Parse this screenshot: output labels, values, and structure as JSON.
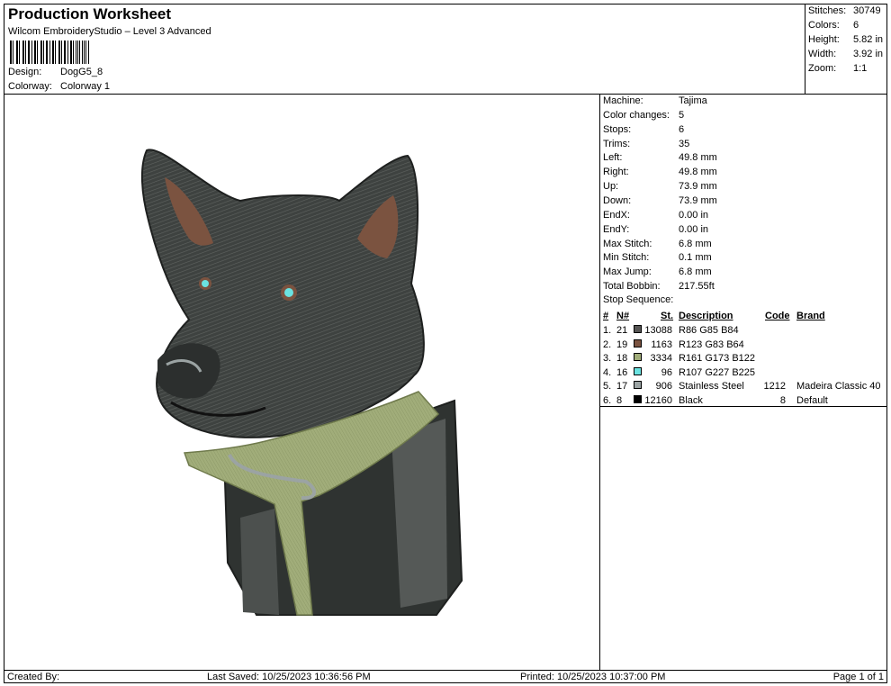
{
  "header": {
    "title": "Production Worksheet",
    "subtitle": "Wilcom EmbroideryStudio – Level 3 Advanced",
    "design_label": "Design:",
    "design_value": "DogG5_8",
    "colorway_label": "Colorway:",
    "colorway_value": "Colorway 1"
  },
  "top_stats": [
    {
      "label": "Stitches:",
      "value": "30749"
    },
    {
      "label": "Colors:",
      "value": "6"
    },
    {
      "label": "Height:",
      "value": "5.82 in"
    },
    {
      "label": "Width:",
      "value": "3.92 in"
    },
    {
      "label": "Zoom:",
      "value": "1:1"
    }
  ],
  "machine_info": [
    {
      "label": "Machine:",
      "value": "Tajima"
    },
    {
      "label": "Color changes:",
      "value": "5"
    },
    {
      "label": "Stops:",
      "value": "6"
    },
    {
      "label": "Trims:",
      "value": "35"
    },
    {
      "label": "Left:",
      "value": "49.8 mm"
    },
    {
      "label": "Right:",
      "value": "49.8 mm"
    },
    {
      "label": "Up:",
      "value": "73.9 mm"
    },
    {
      "label": "Down:",
      "value": "73.9 mm"
    },
    {
      "label": "EndX:",
      "value": "0.00 in"
    },
    {
      "label": "EndY:",
      "value": "0.00 in"
    },
    {
      "label": "Max Stitch:",
      "value": "6.8 mm"
    },
    {
      "label": "Min Stitch:",
      "value": "0.1 mm"
    },
    {
      "label": "Max Jump:",
      "value": "6.8 mm"
    },
    {
      "label": "Total Bobbin:",
      "value": "217.55ft"
    }
  ],
  "stop_sequence": {
    "title": "Stop Sequence:",
    "headers": {
      "num": "#",
      "needle": "N#",
      "stitches": "St.",
      "description": "Description",
      "code": "Code",
      "brand": "Brand"
    },
    "rows": [
      {
        "num": "1.",
        "needle": "21",
        "color": "#565554",
        "stitches": "13088",
        "description": "R86 G85 B84",
        "code": "",
        "brand": ""
      },
      {
        "num": "2.",
        "needle": "19",
        "color": "#7B5340",
        "stitches": "1163",
        "description": "R123 G83 B64",
        "code": "",
        "brand": ""
      },
      {
        "num": "3.",
        "needle": "18",
        "color": "#A1AD7A",
        "stitches": "3334",
        "description": "R161 G173 B122",
        "code": "",
        "brand": ""
      },
      {
        "num": "4.",
        "needle": "16",
        "color": "#6BE3E1",
        "stitches": "96",
        "description": "R107 G227 B225",
        "code": "",
        "brand": ""
      },
      {
        "num": "5.",
        "needle": "17",
        "color": "#9BA3A3",
        "stitches": "906",
        "description": "Stainless Steel",
        "code": "1212",
        "brand": "Madeira Classic 40"
      },
      {
        "num": "6.",
        "needle": "8",
        "color": "#000000",
        "stitches": "12160",
        "description": "Black",
        "code": "8",
        "brand": "Default"
      }
    ]
  },
  "footer": {
    "created_by": "Created By:",
    "last_saved": "Last Saved: 10/25/2023 10:36:56 PM",
    "printed": "Printed: 10/25/2023 10:37:00 PM",
    "page": "Page 1 of 1"
  },
  "palette": {
    "fur_dark": "#3E4240",
    "fur_mid": "#565554",
    "ear_inner": "#7B5340",
    "bandana": "#A1AD7A",
    "eye": "#6BE3E1",
    "ring": "#9BA3A3",
    "black": "#000000"
  }
}
